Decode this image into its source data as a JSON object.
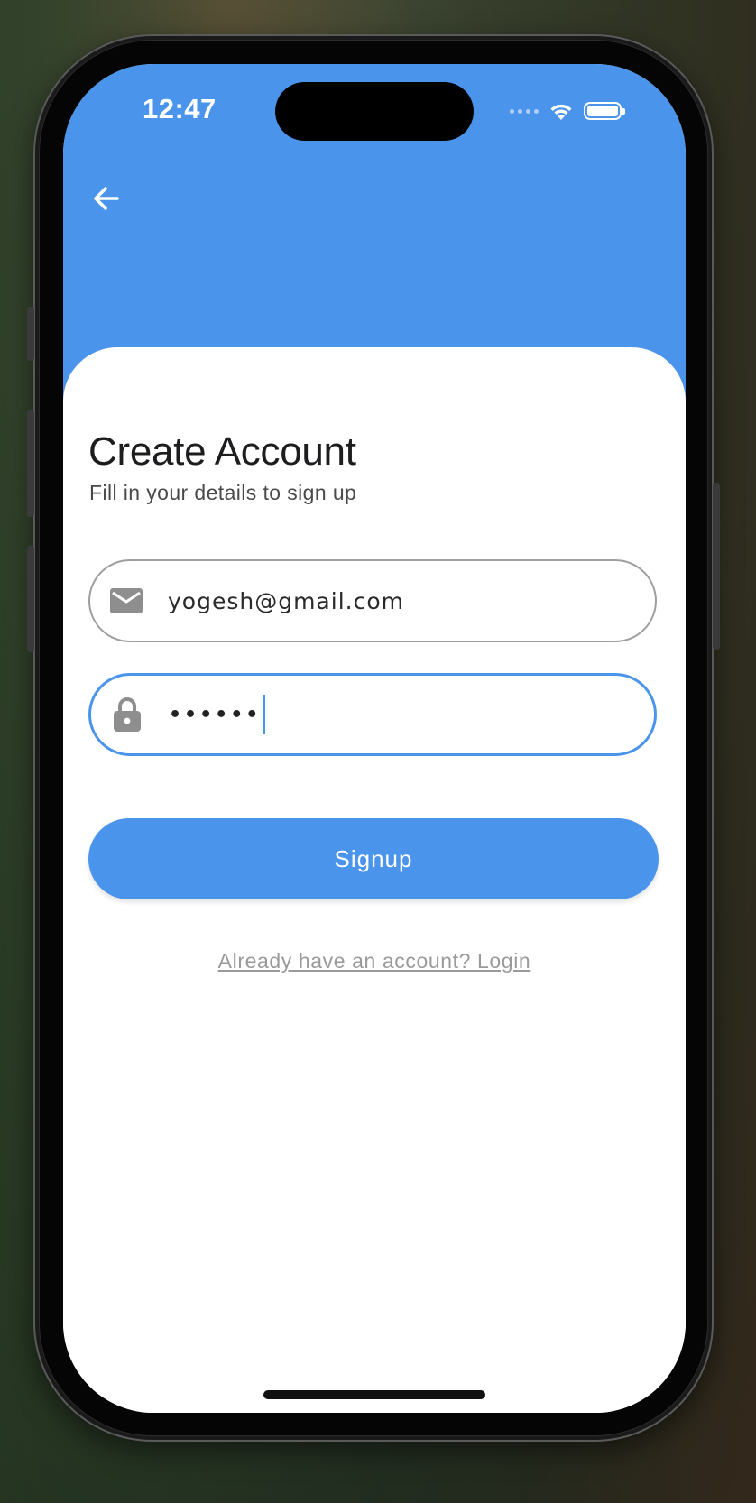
{
  "status_bar": {
    "time": "12:47"
  },
  "header": {
    "background_color": "#4a94ec",
    "back_icon": "arrow-left-icon"
  },
  "form": {
    "title": "Create Account",
    "subtitle": "Fill in your details to sign up",
    "email": {
      "icon": "mail-icon",
      "value": "yogesh@gmail.com"
    },
    "password": {
      "icon": "lock-icon",
      "masked_value": "••••••"
    },
    "signup_label": "Signup",
    "login_link": "Already have an account? Login"
  },
  "colors": {
    "accent": "#4a94ec",
    "field_border": "#9e9e9e"
  }
}
